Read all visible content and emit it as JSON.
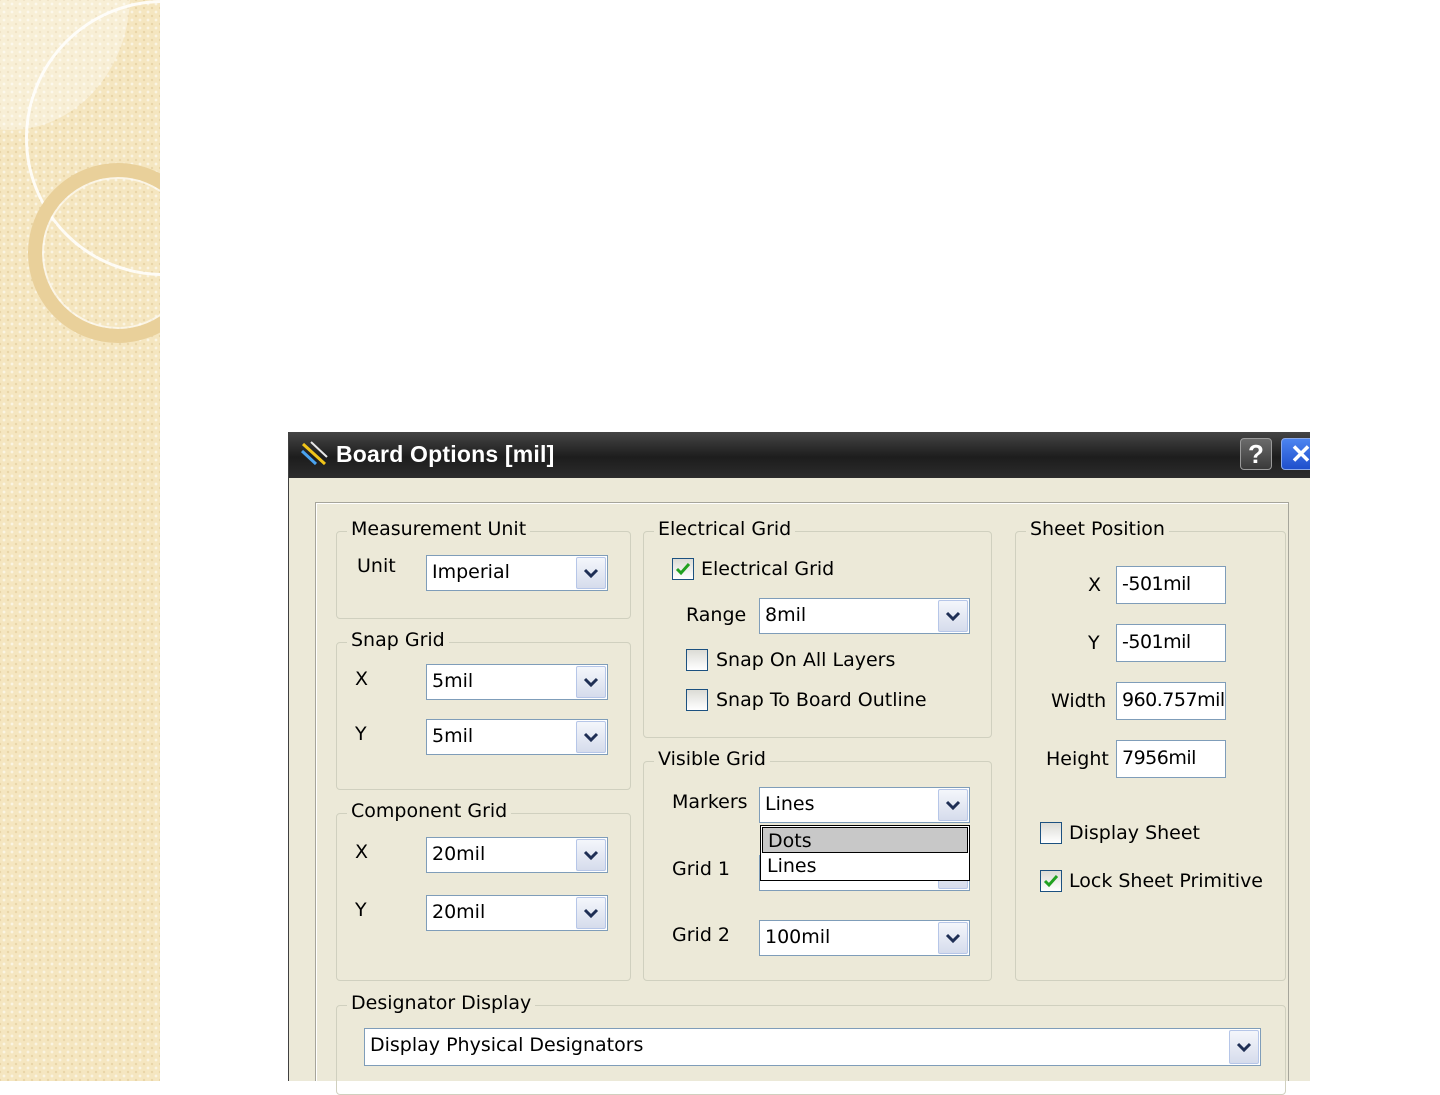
{
  "dialog": {
    "title": "Board Options [mil]",
    "help_label": "?",
    "close_label": "✕"
  },
  "measurement_unit": {
    "legend": "Measurement Unit",
    "unit_label": "Unit",
    "unit_value": "Imperial"
  },
  "snap_grid": {
    "legend": "Snap Grid",
    "x_label": "X",
    "x_value": "5mil",
    "y_label": "Y",
    "y_value": "5mil"
  },
  "component_grid": {
    "legend": "Component Grid",
    "x_label": "X",
    "x_value": "20mil",
    "y_label": "Y",
    "y_value": "20mil"
  },
  "electrical_grid": {
    "legend": "Electrical Grid",
    "enabled_label": "Electrical Grid",
    "enabled": true,
    "range_label": "Range",
    "range_value": "8mil",
    "snap_all_layers_label": "Snap On All Layers",
    "snap_all_layers": false,
    "snap_board_outline_label": "Snap To Board Outline",
    "snap_board_outline": false
  },
  "visible_grid": {
    "legend": "Visible Grid",
    "markers_label": "Markers",
    "markers_value": "Lines",
    "markers_options": [
      "Dots",
      "Lines"
    ],
    "markers_highlighted": "Dots",
    "grid1_label": "Grid 1",
    "grid2_label": "Grid 2",
    "grid2_value": "100mil"
  },
  "sheet_position": {
    "legend": "Sheet Position",
    "x_label": "X",
    "x_value": "-501mil",
    "y_label": "Y",
    "y_value": "-501mil",
    "width_label": "Width",
    "width_value": "960.757mil",
    "height_label": "Height",
    "height_value": "7956mil",
    "display_sheet_label": "Display Sheet",
    "display_sheet": false,
    "lock_sheet_label": "Lock Sheet Primitive",
    "lock_sheet": true
  },
  "designator_display": {
    "legend": "Designator Display",
    "value": "Display Physical Designators"
  },
  "colors": {
    "dialog_face": "#ece9d8",
    "titlebar": "#2a2a2a",
    "close_button": "#2f62de",
    "input_border": "#7f9db9"
  }
}
